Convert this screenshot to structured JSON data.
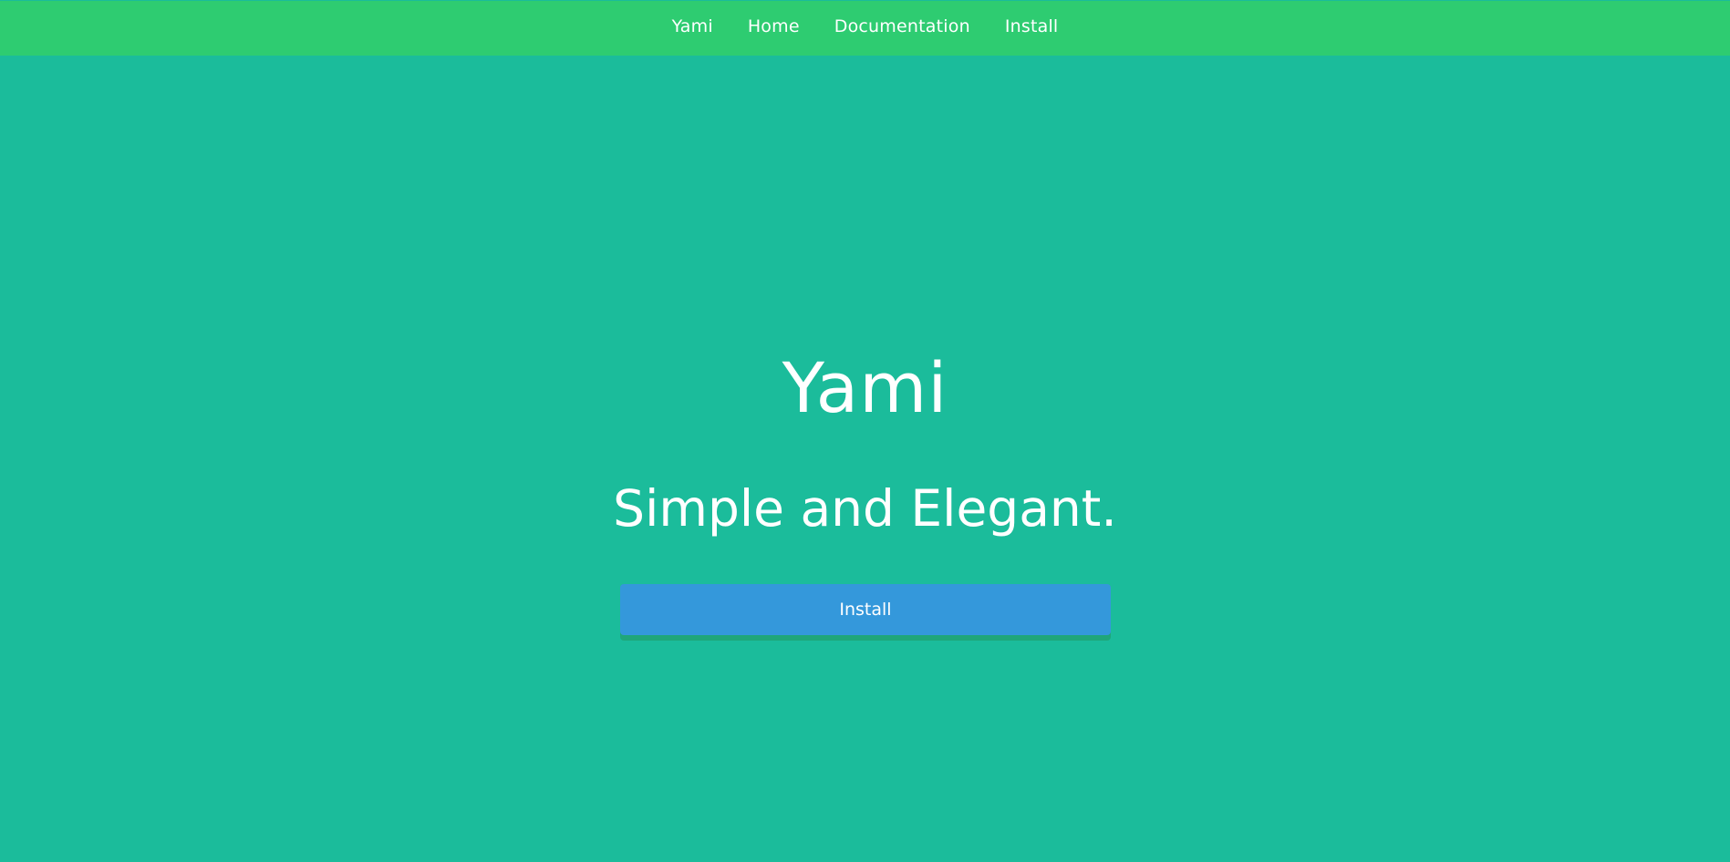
{
  "nav": {
    "items": [
      {
        "label": "Yami"
      },
      {
        "label": "Home"
      },
      {
        "label": "Documentation"
      },
      {
        "label": "Install"
      }
    ]
  },
  "hero": {
    "title": "Yami",
    "tagline": "Simple and Elegant.",
    "install_label": "Install"
  },
  "colors": {
    "background": "#1bbc9b",
    "navbar": "#2ecc71",
    "button": "#3498db",
    "button_shadow": "#1fa67a",
    "text": "#ffffff"
  }
}
